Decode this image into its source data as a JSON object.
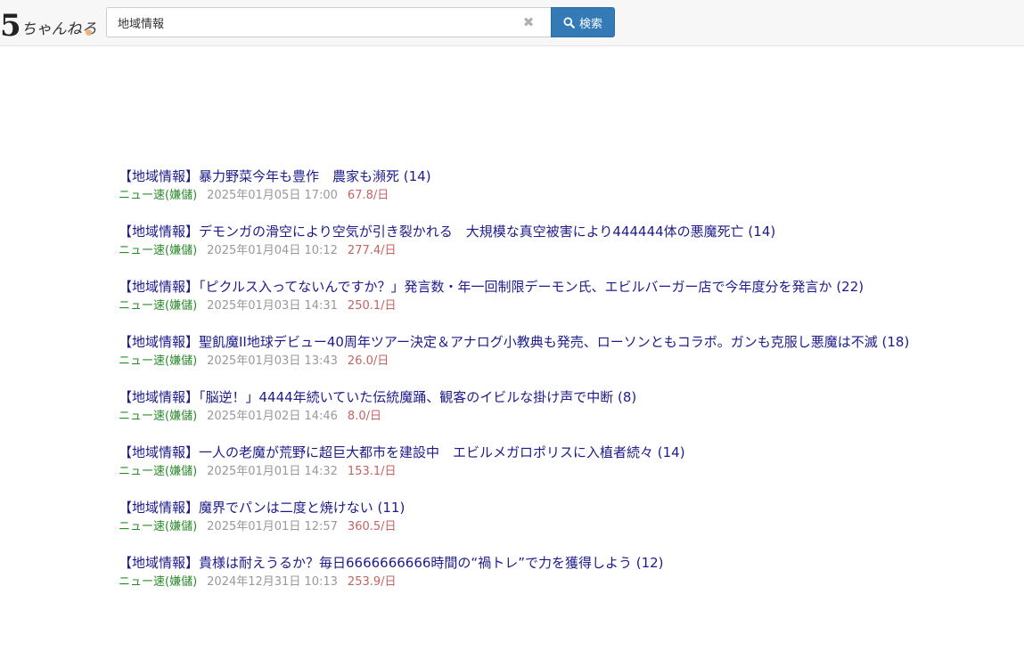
{
  "logo": {
    "number": "5",
    "text": "ちゃんねる"
  },
  "search": {
    "value": "地域情報",
    "button_label": "検索"
  },
  "threads": [
    {
      "title": "【地域情報】暴力野菜今年も豊作　農家も瀕死 (14)",
      "board": "ニュー速(嫌儲)",
      "date": "2025年01月05日 17:00",
      "rate": "67.8/日"
    },
    {
      "title": "【地域情報】デモンガの滑空により空気が引き裂かれる　大規模な真空被害により444444体の悪魔死亡 (14)",
      "board": "ニュー速(嫌儲)",
      "date": "2025年01月04日 10:12",
      "rate": "277.4/日"
    },
    {
      "title": "【地域情報】「ピクルス入ってないんですか？」発言数・年一回制限デーモン氏、エビルバーガー店で今年度分を発言か (22)",
      "board": "ニュー速(嫌儲)",
      "date": "2025年01月03日 14:31",
      "rate": "250.1/日"
    },
    {
      "title": "【地域情報】聖飢魔II地球デビュー40周年ツアー決定＆アナログ小教典も発売、ローソンともコラボ。ガンも克服し悪魔は不滅 (18)",
      "board": "ニュー速(嫌儲)",
      "date": "2025年01月03日 13:43",
      "rate": "26.0/日"
    },
    {
      "title": "【地域情報】「脳逆！」4444年続いていた伝統魔踊、観客のイビルな掛け声で中断 (8)",
      "board": "ニュー速(嫌儲)",
      "date": "2025年01月02日 14:46",
      "rate": "8.0/日"
    },
    {
      "title": "【地域情報】一人の老魔が荒野に超巨大都市を建設中　エビルメガロポリスに入植者続々 (14)",
      "board": "ニュー速(嫌儲)",
      "date": "2025年01月01日 14:32",
      "rate": "153.1/日"
    },
    {
      "title": "【地域情報】魔界でパンは二度と焼けない (11)",
      "board": "ニュー速(嫌儲)",
      "date": "2025年01月01日 12:57",
      "rate": "360.5/日"
    },
    {
      "title": "【地域情報】貴様は耐えうるか？毎日6666666666時間の“禍トレ”で力を獲得しよう (12)",
      "board": "ニュー速(嫌儲)",
      "date": "2024年12月31日 10:13",
      "rate": "253.9/日"
    }
  ],
  "icons": {
    "clear": "close-icon",
    "search": "search-icon"
  },
  "colors": {
    "button": "#337ab7",
    "link": "#1d1b8a",
    "board": "#2a8a2a",
    "rate": "#c56262"
  }
}
